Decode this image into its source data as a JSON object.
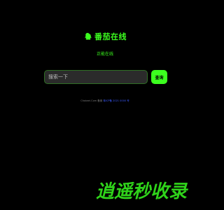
{
  "brand": {
    "title": "番茄在线",
    "subtitle": "正能在线",
    "logo_icon": "qq-penguin-icon",
    "accent_color": "#3cff1f"
  },
  "search": {
    "placeholder": "搜索一下",
    "button_label": "查询"
  },
  "footer": {
    "prefix": "Chaiwei.Com 备案",
    "links": [
      "粤ICP备",
      "2021",
      "0000",
      "号"
    ]
  },
  "watermark": {
    "text": "逍遥秒收录",
    "icon": "watermark-logo"
  }
}
